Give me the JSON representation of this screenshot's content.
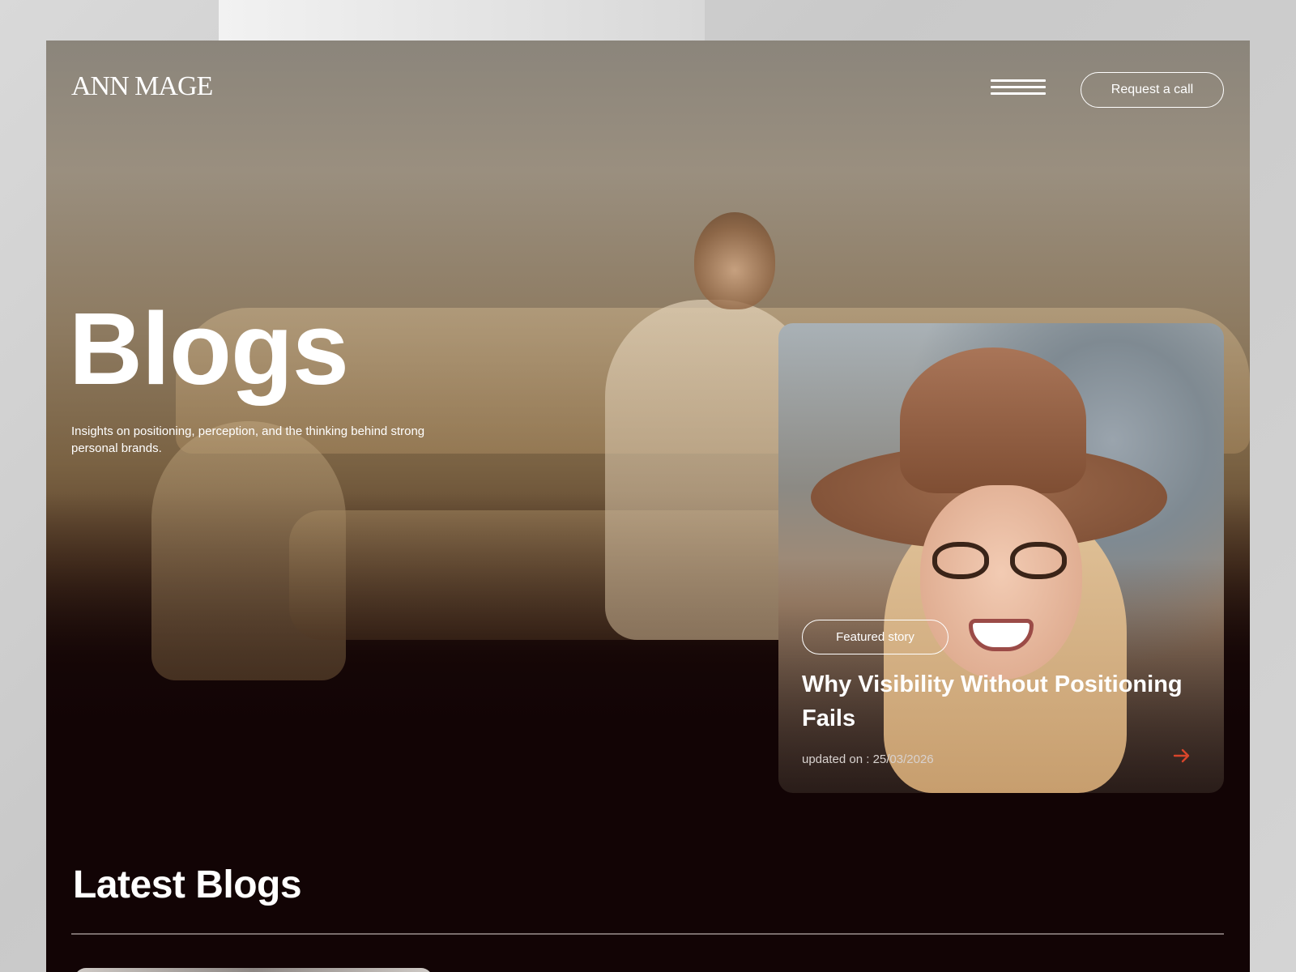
{
  "header": {
    "logo": "ANN MAGE",
    "menu_icon": "hamburger-menu-icon",
    "cta_label": "Request a call"
  },
  "hero": {
    "title": "Blogs",
    "subtitle": "Insights on positioning, perception, and the thinking behind strong personal brands."
  },
  "featured": {
    "badge": "Featured story",
    "title": "Why Visibility Without Positioning Fails",
    "date": "updated on : 25/03/2026",
    "arrow_icon": "arrow-right-icon",
    "arrow_color": "#d8452b"
  },
  "latest": {
    "title": "Latest Blogs"
  },
  "colors": {
    "background": "#120405",
    "text": "#ffffff",
    "accent": "#d8452b"
  }
}
